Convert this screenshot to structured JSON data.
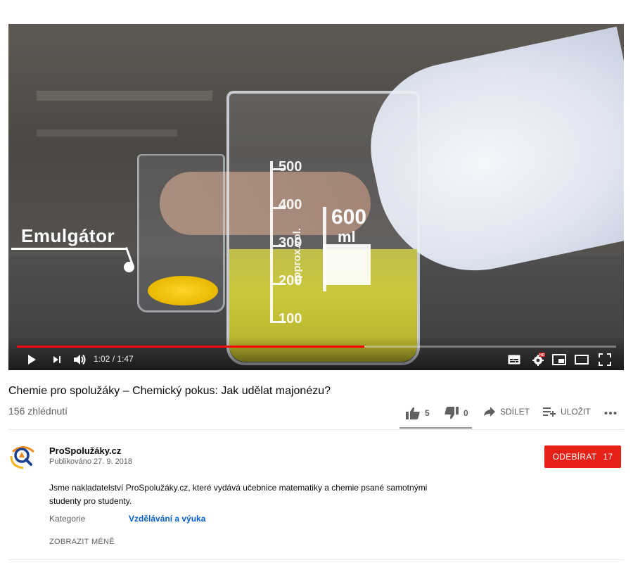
{
  "player": {
    "overlay_label": "Emulgátor",
    "beaker_big": {
      "graduations": [
        "500",
        "400",
        "300",
        "200",
        "100"
      ],
      "capacity": "600",
      "unit": "ml",
      "side_text": "approx.vol."
    },
    "time": "1:02 / 1:47",
    "progress_fraction": 0.58,
    "icons": [
      "play-icon",
      "next-icon",
      "volume-icon",
      "subtitles-icon",
      "settings-icon",
      "miniplayer-icon",
      "theater-icon",
      "fullscreen-icon"
    ],
    "hd_badge": "HD"
  },
  "video": {
    "title": "Chemie pro spolužáky – Chemický pokus: Jak udělat majonézu?",
    "views": "156 zhlédnutí",
    "actions": {
      "likes": "5",
      "dislikes": "0",
      "share_label": "SDÍLET",
      "save_label": "ULOŽIT"
    }
  },
  "channel": {
    "name": "ProSpolužáky.cz",
    "published": "Publikováno 27. 9. 2018",
    "subscribe_label": "ODEBÍRAT",
    "subscriber_count": "17",
    "description": "Jsme nakladatelství ProSpolužáky.cz, které vydává učebnice matematiky a chemie psané samotnými studenty pro studenty.",
    "category_label": "Kategorie",
    "category_value": "Vzdělávání a výuka",
    "show_less_label": "ZOBRAZIT MÉNĚ"
  },
  "colors": {
    "subscribe": "#e62117",
    "progress": "#ff0000",
    "link": "#065fd4"
  }
}
